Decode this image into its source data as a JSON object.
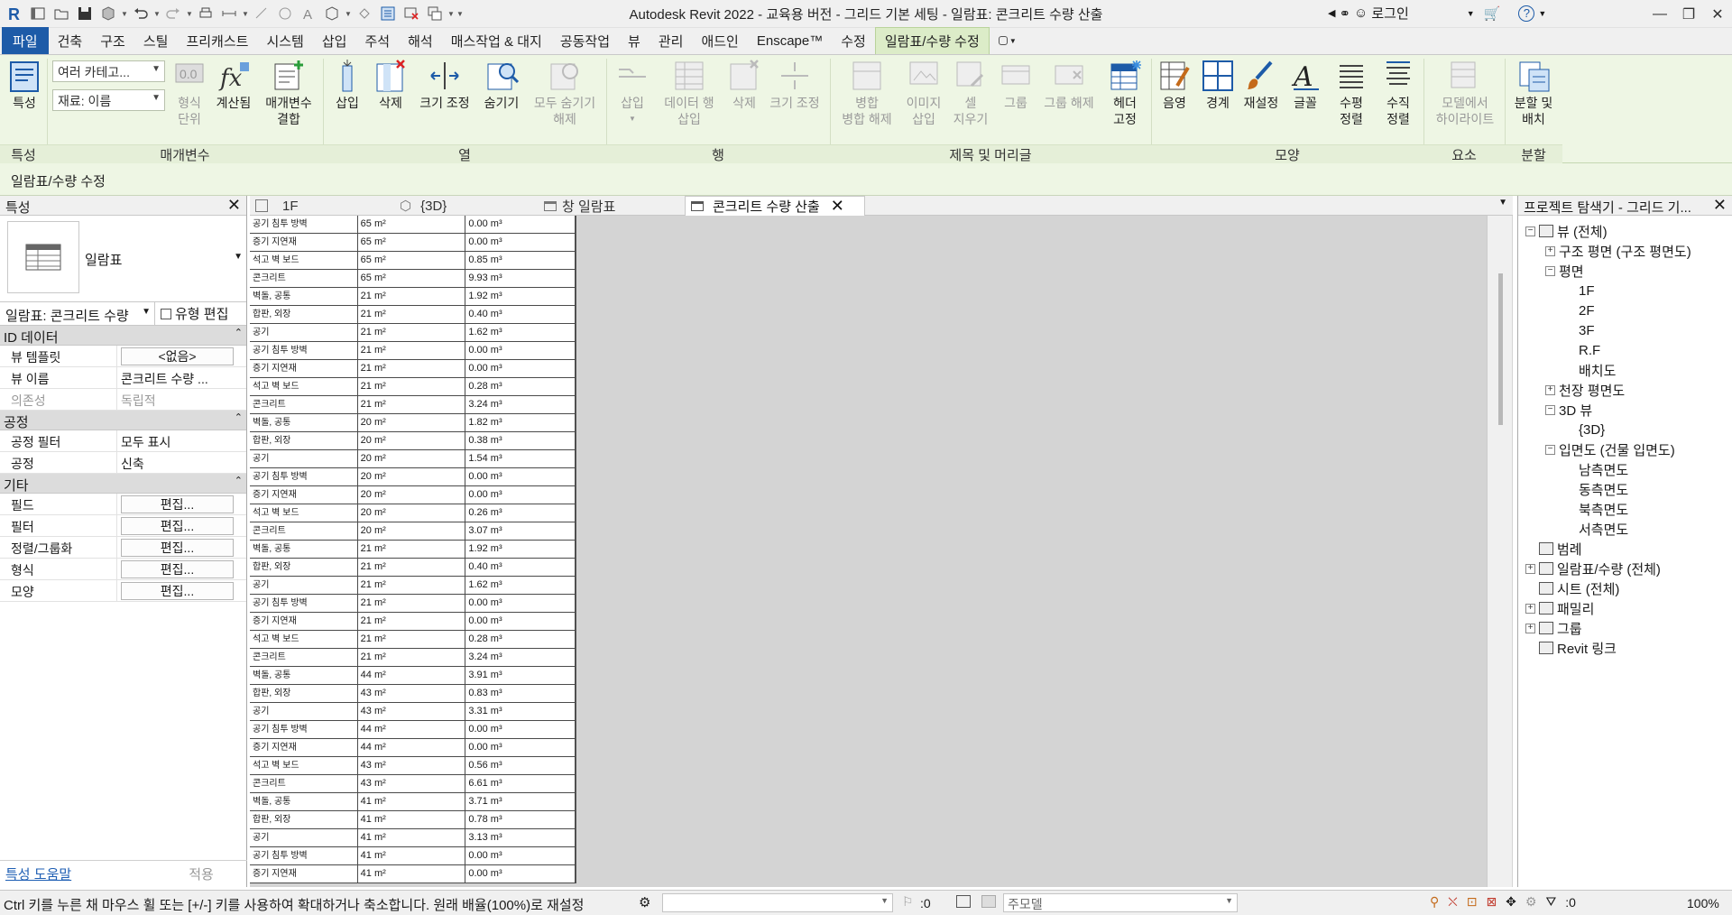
{
  "window": {
    "title": "Autodesk Revit 2022 - 교육용 버전 - 그리드 기본 세팅 - 일람표: 콘크리트 수량 산출",
    "user_label": "로그인"
  },
  "ribbon_tabs": [
    {
      "label": "파일"
    },
    {
      "label": "건축"
    },
    {
      "label": "구조"
    },
    {
      "label": "스틸"
    },
    {
      "label": "프리캐스트"
    },
    {
      "label": "시스템"
    },
    {
      "label": "삽입"
    },
    {
      "label": "주석"
    },
    {
      "label": "해석"
    },
    {
      "label": "매스작업 & 대지"
    },
    {
      "label": "공동작업"
    },
    {
      "label": "뷰"
    },
    {
      "label": "관리"
    },
    {
      "label": "애드인"
    },
    {
      "label": "Enscape™"
    },
    {
      "label": "수정"
    },
    {
      "label": "일람표/수량 수정"
    }
  ],
  "ribbon": {
    "properties_btn": "특성",
    "combo_category": "여러 카테고...",
    "combo_material": "재료: 이름",
    "format_unit": "형식\n단위",
    "calculated": "계산됨",
    "param_combine": "매개변수\n결합",
    "col_insert": "삽입",
    "col_delete": "삭제",
    "col_resize": "크기 조정",
    "col_hide": "숨기기",
    "col_unhide": "모두 숨기기\n해제",
    "row_insert": "삽입",
    "row_insert_data": "데이터 행\n삽입",
    "row_delete": "삭제",
    "row_resize": "크기 조정",
    "merge_unmerge": "병합\n병합 해제",
    "insert_image": "이미지\n삽입",
    "clear_cell": "셀\n지우기",
    "group": "그룹",
    "ungroup": "그룹 해제",
    "freeze_header": "헤더\n고정",
    "shading": "음영",
    "borders": "경계",
    "reset": "재설정",
    "font": "글꼴",
    "align_horizontal": "수평\n정렬",
    "align_vertical": "수직\n정렬",
    "highlight_model": "모델에서\n하이라이트",
    "split_place": "분할 및\n배치",
    "panels": [
      {
        "label": "특성"
      },
      {
        "label": "매개변수"
      },
      {
        "label": "열"
      },
      {
        "label": "행"
      },
      {
        "label": "제목 및 머리글"
      },
      {
        "label": "모양"
      },
      {
        "label": "요소"
      },
      {
        "label": "분할"
      }
    ]
  },
  "context_bar": "일람표/수량 수정",
  "properties": {
    "title": "특성",
    "type_name": "일람표",
    "instance_selector": "일람표: 콘크리트 수량",
    "edit_type": "유형 편집",
    "groups": [
      {
        "name": "ID 데이터",
        "rows": [
          {
            "key": "뷰 템플릿",
            "value": "<없음>",
            "button": true,
            "dim": false
          },
          {
            "key": "뷰 이름",
            "value": "콘크리트 수량 ...",
            "button": false,
            "dim": false
          },
          {
            "key": "의존성",
            "value": "독립적",
            "button": false,
            "dim": true
          }
        ]
      },
      {
        "name": "공정",
        "rows": [
          {
            "key": "공정 필터",
            "value": "모두 표시",
            "button": false,
            "dim": false
          },
          {
            "key": "공정",
            "value": "신축",
            "button": false,
            "dim": false
          }
        ]
      },
      {
        "name": "기타",
        "rows": [
          {
            "key": "필드",
            "value": "편집...",
            "button": true,
            "dim": false
          },
          {
            "key": "필터",
            "value": "편집...",
            "button": true,
            "dim": false
          },
          {
            "key": "정렬/그룹화",
            "value": "편집...",
            "button": true,
            "dim": false
          },
          {
            "key": "형식",
            "value": "편집...",
            "button": true,
            "dim": false
          },
          {
            "key": "모양",
            "value": "편집...",
            "button": true,
            "dim": false
          }
        ]
      }
    ],
    "help_link": "특성 도움말",
    "apply": "적용"
  },
  "view_tabs": [
    {
      "label": "1F",
      "icon": "floor-plan-icon",
      "active": false
    },
    {
      "label": "{3D}",
      "icon": "3d-view-icon",
      "active": false
    },
    {
      "label": "창 일람표",
      "icon": "schedule-icon",
      "active": false
    },
    {
      "label": "콘크리트 수량 산출",
      "icon": "schedule-icon",
      "active": true
    }
  ],
  "schedule_rows": [
    [
      "공기 침투 방벽",
      "65 m²",
      "0.00 m³"
    ],
    [
      "증기 지연재",
      "65 m²",
      "0.00 m³"
    ],
    [
      "석고 벽 보드",
      "65 m²",
      "0.85 m³"
    ],
    [
      "콘크리트",
      "65 m²",
      "9.93 m³"
    ],
    [
      "벽돌, 공통",
      "21 m²",
      "1.92 m³"
    ],
    [
      "합판, 외장",
      "21 m²",
      "0.40 m³"
    ],
    [
      "공기",
      "21 m²",
      "1.62 m³"
    ],
    [
      "공기 침투 방벽",
      "21 m²",
      "0.00 m³"
    ],
    [
      "증기 지연재",
      "21 m²",
      "0.00 m³"
    ],
    [
      "석고 벽 보드",
      "21 m²",
      "0.28 m³"
    ],
    [
      "콘크리트",
      "21 m²",
      "3.24 m³"
    ],
    [
      "벽돌, 공통",
      "20 m²",
      "1.82 m³"
    ],
    [
      "합판, 외장",
      "20 m²",
      "0.38 m³"
    ],
    [
      "공기",
      "20 m²",
      "1.54 m³"
    ],
    [
      "공기 침투 방벽",
      "20 m²",
      "0.00 m³"
    ],
    [
      "증기 지연재",
      "20 m²",
      "0.00 m³"
    ],
    [
      "석고 벽 보드",
      "20 m²",
      "0.26 m³"
    ],
    [
      "콘크리트",
      "20 m²",
      "3.07 m³"
    ],
    [
      "벽돌, 공통",
      "21 m²",
      "1.92 m³"
    ],
    [
      "합판, 외장",
      "21 m²",
      "0.40 m³"
    ],
    [
      "공기",
      "21 m²",
      "1.62 m³"
    ],
    [
      "공기 침투 방벽",
      "21 m²",
      "0.00 m³"
    ],
    [
      "증기 지연재",
      "21 m²",
      "0.00 m³"
    ],
    [
      "석고 벽 보드",
      "21 m²",
      "0.28 m³"
    ],
    [
      "콘크리트",
      "21 m²",
      "3.24 m³"
    ],
    [
      "벽돌, 공통",
      "44 m²",
      "3.91 m³"
    ],
    [
      "합판, 외장",
      "43 m²",
      "0.83 m³"
    ],
    [
      "공기",
      "43 m²",
      "3.31 m³"
    ],
    [
      "공기 침투 방벽",
      "44 m²",
      "0.00 m³"
    ],
    [
      "증기 지연재",
      "44 m²",
      "0.00 m³"
    ],
    [
      "석고 벽 보드",
      "43 m²",
      "0.56 m³"
    ],
    [
      "콘크리트",
      "43 m²",
      "6.61 m³"
    ],
    [
      "벽돌, 공통",
      "41 m²",
      "3.71 m³"
    ],
    [
      "합판, 외장",
      "41 m²",
      "0.78 m³"
    ],
    [
      "공기",
      "41 m²",
      "3.13 m³"
    ],
    [
      "공기 침투 방벽",
      "41 m²",
      "0.00 m³"
    ],
    [
      "증기 지연재",
      "41 m²",
      "0.00 m³"
    ]
  ],
  "browser": {
    "title": "프로젝트 탐색기 - 그리드 기...",
    "nodes": [
      {
        "label": "뷰 (전체)",
        "toggle": "−",
        "icon": true
      },
      {
        "label": "구조 평면 (구조 평면도)",
        "toggle": "+",
        "icon": false
      },
      {
        "label": "평면",
        "toggle": "−",
        "icon": false
      },
      {
        "label": "1F",
        "toggle": "",
        "icon": false
      },
      {
        "label": "2F",
        "toggle": "",
        "icon": false
      },
      {
        "label": "3F",
        "toggle": "",
        "icon": false
      },
      {
        "label": "R.F",
        "toggle": "",
        "icon": false
      },
      {
        "label": "배치도",
        "toggle": "",
        "icon": false
      },
      {
        "label": "천장 평면도",
        "toggle": "+",
        "icon": false
      },
      {
        "label": "3D 뷰",
        "toggle": "−",
        "icon": false
      },
      {
        "label": "{3D}",
        "toggle": "",
        "icon": false
      },
      {
        "label": "입면도 (건물 입면도)",
        "toggle": "−",
        "icon": false
      },
      {
        "label": "남측면도",
        "toggle": "",
        "icon": false
      },
      {
        "label": "동측면도",
        "toggle": "",
        "icon": false
      },
      {
        "label": "북측면도",
        "toggle": "",
        "icon": false
      },
      {
        "label": "서측면도",
        "toggle": "",
        "icon": false
      },
      {
        "label": "범례",
        "toggle": "",
        "icon": true
      },
      {
        "label": "일람표/수량 (전체)",
        "toggle": "+",
        "icon": true
      },
      {
        "label": "시트 (전체)",
        "toggle": "",
        "icon": true
      },
      {
        "label": "패밀리",
        "toggle": "+",
        "icon": true
      },
      {
        "label": "그룹",
        "toggle": "+",
        "icon": true
      },
      {
        "label": "Revit 링크",
        "toggle": "",
        "icon": true
      }
    ]
  },
  "status": {
    "message": "Ctrl 키를 누른 채 마우스 휠 또는 [+/-] 키를 사용하여 확대하거나 축소합니다. 원래 배율(100%)로 재설정",
    "workset_value": ":0",
    "model_placeholder": "주모델",
    "filter_count": ":0",
    "zoom": "100%"
  }
}
